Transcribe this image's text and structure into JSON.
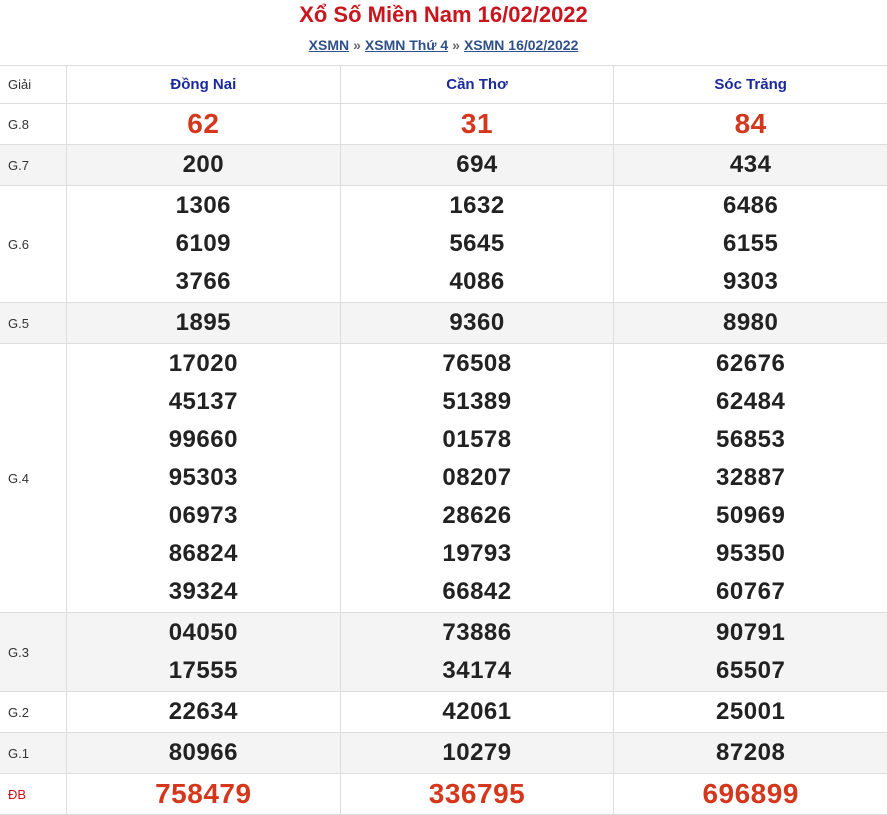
{
  "title": "Xổ Số Miền Nam 16/02/2022",
  "breadcrumb": {
    "items": [
      "XSMN",
      "XSMN Thứ 4",
      "XSMN 16/02/2022"
    ],
    "separator": "»"
  },
  "table": {
    "label_header": "Giải",
    "provinces": [
      "Đồng Nai",
      "Cần Thơ",
      "Sóc Trăng"
    ],
    "prizes": [
      {
        "label": "G.8",
        "values": [
          [
            "62"
          ],
          [
            "31"
          ],
          [
            "84"
          ]
        ]
      },
      {
        "label": "G.7",
        "values": [
          [
            "200"
          ],
          [
            "694"
          ],
          [
            "434"
          ]
        ]
      },
      {
        "label": "G.6",
        "values": [
          [
            "1306",
            "6109",
            "3766"
          ],
          [
            "1632",
            "5645",
            "4086"
          ],
          [
            "6486",
            "6155",
            "9303"
          ]
        ]
      },
      {
        "label": "G.5",
        "values": [
          [
            "1895"
          ],
          [
            "9360"
          ],
          [
            "8980"
          ]
        ]
      },
      {
        "label": "G.4",
        "values": [
          [
            "17020",
            "45137",
            "99660",
            "95303",
            "06973",
            "86824",
            "39324"
          ],
          [
            "76508",
            "51389",
            "01578",
            "08207",
            "28626",
            "19793",
            "66842"
          ],
          [
            "62676",
            "62484",
            "56853",
            "32887",
            "50969",
            "95350",
            "60767"
          ]
        ]
      },
      {
        "label": "G.3",
        "values": [
          [
            "04050",
            "17555"
          ],
          [
            "73886",
            "34174"
          ],
          [
            "90791",
            "65507"
          ]
        ]
      },
      {
        "label": "G.2",
        "values": [
          [
            "22634"
          ],
          [
            "42061"
          ],
          [
            "25001"
          ]
        ]
      },
      {
        "label": "G.1",
        "values": [
          [
            "80966"
          ],
          [
            "10279"
          ],
          [
            "87208"
          ]
        ]
      },
      {
        "label": "ĐB",
        "values": [
          [
            "758479"
          ],
          [
            "336795"
          ],
          [
            "696899"
          ]
        ]
      }
    ]
  },
  "colors": {
    "title": "#c9151e",
    "link": "#2f4f8a",
    "province": "#1a2a9c",
    "highlight_number": "#d4371c",
    "alt_row": "#f4f4f4"
  }
}
